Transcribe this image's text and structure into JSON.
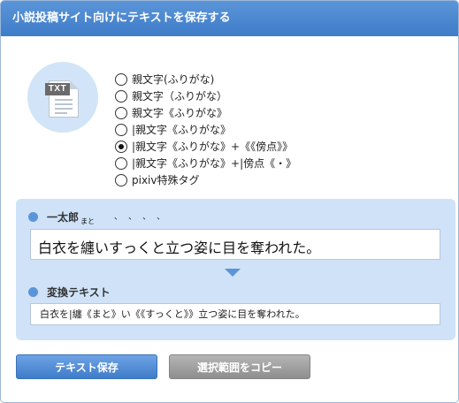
{
  "dialog": {
    "title": "小説投稿サイト向けにテキストを保存する"
  },
  "file_icon": {
    "label": "TXT",
    "icon": "txt-file-icon"
  },
  "format_options": {
    "selected_index": 4,
    "items": [
      {
        "label": "親文字(ふりがな)"
      },
      {
        "label": "親文字（ふりがな）"
      },
      {
        "label": "親文字《ふりがな》"
      },
      {
        "label": "|親文字《ふりがな》"
      },
      {
        "label": "|親文字《ふりがな》+《《傍点》》"
      },
      {
        "label": "|親文字《ふりがな》+|傍点《・》"
      },
      {
        "label": "pixiv特殊タグ"
      }
    ]
  },
  "preview": {
    "heading": "一太郎",
    "text_before": "白衣を",
    "ruby_base": "纏",
    "ruby_text": "まと",
    "text_mid": "い",
    "emphasis": [
      "す",
      "っ",
      "く",
      "と"
    ],
    "text_after": "立つ姿に目を奪われた。"
  },
  "output": {
    "heading": "変換テキスト",
    "text": "白衣を|纏《まと》い《《すっくと》》立つ姿に目を奪われた。"
  },
  "buttons": {
    "save": "テキスト保存",
    "copy": "選択範囲をコピー"
  },
  "colors": {
    "title_bar": "#4a86cf",
    "accent": "#5b95d9",
    "panel_bg": "#cfe2f8",
    "secondary_button": "#9e9e9e"
  }
}
